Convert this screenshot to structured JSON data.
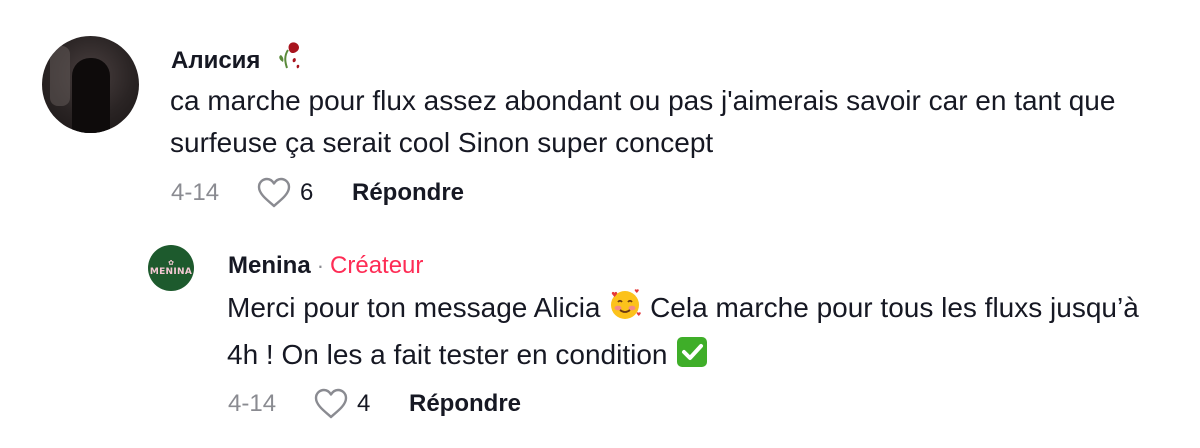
{
  "comments": [
    {
      "username": "Алисия",
      "username_emoji": "rose-emoji",
      "text": "ca marche pour flux assez abondant ou pas j'aimerais savoir car en tant que surfeuse ça serait cool Sinon super concept",
      "date": "4-14",
      "likes": "6",
      "reply_label": "Répondre"
    }
  ],
  "reply": {
    "username": "Menina",
    "separator": "·",
    "badge": "Créateur",
    "avatar_text": "MENINA",
    "text_part1": "Merci pour ton message Alicia",
    "text_part2": "Cela marche pour tous les fluxs jusqu’à 4h ! On les a fait tester en condition",
    "date": "4-14",
    "likes": "4",
    "reply_label": "Répondre"
  },
  "colors": {
    "creator_badge": "#fe2c55",
    "muted": "#8a8b91",
    "logo_bg": "#1d5a2d",
    "check_green": "#3fae29"
  }
}
